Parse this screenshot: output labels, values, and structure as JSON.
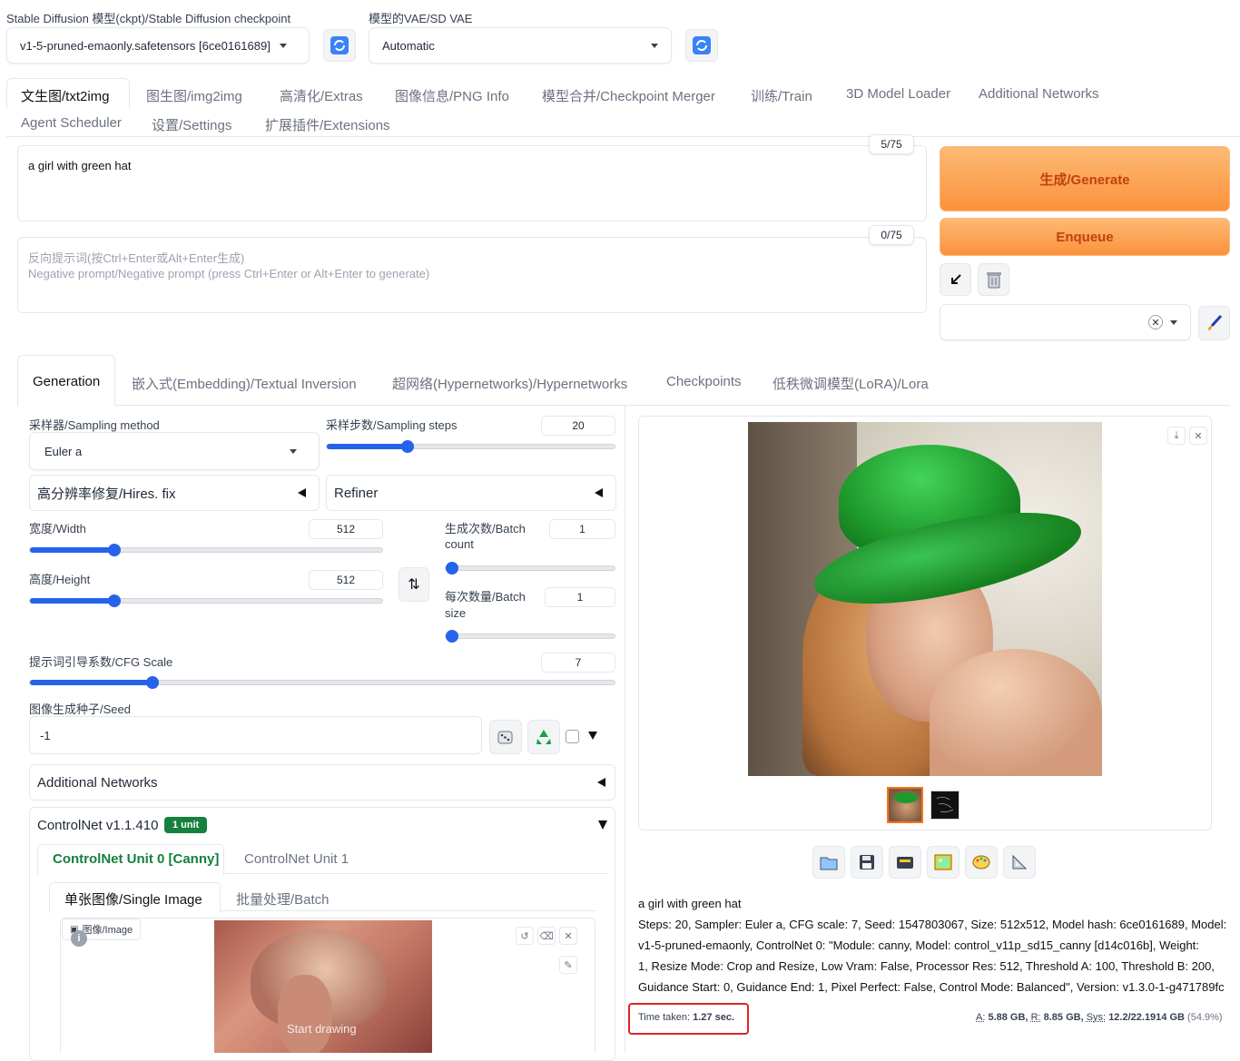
{
  "top": {
    "ckpt_label": "Stable Diffusion 模型(ckpt)/Stable Diffusion checkpoint",
    "ckpt_value": "v1-5-pruned-emaonly.safetensors [6ce0161689]",
    "vae_label": "模型的VAE/SD VAE",
    "vae_value": "Automatic"
  },
  "main_tabs": [
    "文生图/txt2img",
    "图生图/img2img",
    "高清化/Extras",
    "图像信息/PNG Info",
    "模型合并/Checkpoint Merger",
    "训练/Train",
    "3D Model Loader",
    "Additional Networks",
    "Agent Scheduler",
    "设置/Settings",
    "扩展插件/Extensions"
  ],
  "prompt": {
    "value": "a girl with green hat",
    "token_count": "5/75",
    "neg_placeholder_1": "反向提示词(按Ctrl+Enter或Alt+Enter生成)",
    "neg_placeholder_2": "Negative prompt/Negative prompt (press Ctrl+Enter or Alt+Enter to generate)",
    "neg_token_count": "0/75"
  },
  "actions": {
    "generate": "生成/Generate",
    "enqueue": "Enqueue"
  },
  "sub_tabs": [
    "Generation",
    "嵌入式(Embedding)/Textual Inversion",
    "超网络(Hypernetworks)/Hypernetworks",
    "Checkpoints",
    "低秩微调模型(LoRA)/Lora"
  ],
  "params": {
    "sampler_label": "采样器/Sampling method",
    "sampler_value": "Euler a",
    "steps_label": "采样步数/Sampling steps",
    "steps_value": "20",
    "steps_frac": 0.28,
    "hires_label": "高分辨率修复/Hires. fix",
    "refiner_label": "Refiner",
    "width_label": "宽度/Width",
    "width_value": "512",
    "width_frac": 0.24,
    "height_label": "高度/Height",
    "height_value": "512",
    "height_frac": 0.24,
    "batch_count_label_1": "生成次数/Batch",
    "batch_count_label_2": "count",
    "batch_count_value": "1",
    "batch_size_label_1": "每次数量/Batch",
    "batch_size_label_2": "size",
    "batch_size_value": "1",
    "cfg_label": "提示词引导系数/CFG Scale",
    "cfg_value": "7",
    "cfg_frac": 0.21,
    "seed_label": "图像生成种子/Seed",
    "seed_value": "-1"
  },
  "addnet": {
    "label": "Additional Networks"
  },
  "controlnet": {
    "label": "ControlNet v1.1.410",
    "badge": "1 unit",
    "unit0": "ControlNet Unit 0 [Canny]",
    "unit1": "ControlNet Unit 1",
    "tab_single": "单张图像/Single Image",
    "tab_batch": "批量处理/Batch",
    "image_label": "图像/Image",
    "overlay": "Start drawing"
  },
  "output": {
    "caption_prompt": "a girl with green hat",
    "info_1": "Steps: 20, Sampler: Euler a, CFG scale: 7, Seed: 1547803067, Size: 512x512, Model hash: 6ce0161689, Model:",
    "info_2": "v1-5-pruned-emaonly, ControlNet 0: \"Module: canny, Model: control_v11p_sd15_canny [d14c016b], Weight:",
    "info_3": "1, Resize Mode: Crop and Resize, Low Vram: False, Processor Res: 512, Threshold A: 100, Threshold B: 200,",
    "info_4": "Guidance Start: 0, Guidance End: 1, Pixel Perfect: False, Control Mode: Balanced\", Version: v1.3.0-1-g471789fc",
    "time_prefix": "Time taken:",
    "time_value": "1.27 sec.",
    "mem_a_label": "A:",
    "mem_a": "5.88 GB,",
    "mem_r_label": "R:",
    "mem_r": "8.85 GB,",
    "mem_sys_label": "Sys:",
    "mem_sys": "12.2/22.1914 GB",
    "mem_pct": "(54.9%)"
  },
  "colors": {
    "accent": "#2563eb",
    "orange": "#fb923c",
    "green": "#15803d",
    "highlight": "#dc2626"
  }
}
